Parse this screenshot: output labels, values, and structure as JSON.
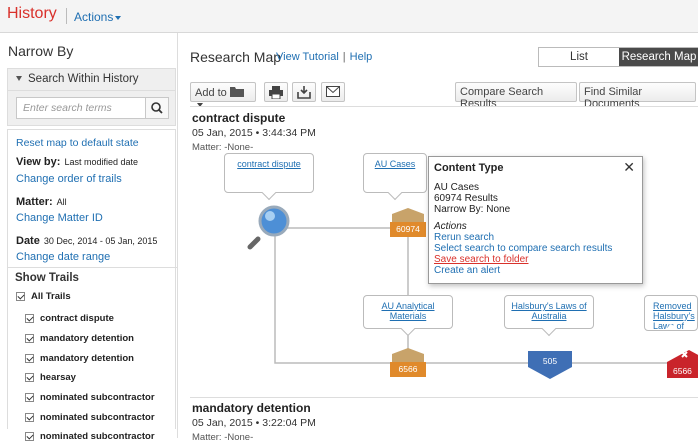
{
  "topbar": {
    "title": "History",
    "actions_label": "Actions"
  },
  "sidebar": {
    "title": "Narrow By",
    "search_within": {
      "label": "Search Within History",
      "placeholder": "Enter search terms"
    },
    "reset_link": "Reset map to default state",
    "view_by": {
      "label": "View by:",
      "value": "Last modified date",
      "link": "Change order of trails"
    },
    "matter": {
      "label": "Matter:",
      "value": "All",
      "link": "Change Matter ID"
    },
    "date": {
      "label": "Date",
      "value": "30 Dec, 2014 - 05 Jan, 2015",
      "link": "Change date range"
    },
    "show_trails": {
      "title": "Show Trails",
      "all_label": "All Trails",
      "items": [
        "contract dispute",
        "mandatory detention",
        "mandatory detention",
        "hearsay",
        "nominated subcontractor",
        "nominated subcontractor",
        "nominated subcontractor"
      ]
    }
  },
  "main": {
    "title": "Research Map",
    "view_tutorial": "View Tutorial",
    "help": "Help",
    "view_list": "List",
    "view_map": "Research Map",
    "toolbar": {
      "add_to": "Add to",
      "compare": "Compare Search Results",
      "similar": "Find Similar Documents"
    },
    "trails": [
      {
        "title": "contract dispute",
        "date": "05 Jan, 2015  • 3:44:34 PM",
        "matter": "Matter: -None-",
        "nodes": {
          "query": "contract dispute",
          "au_cases": "AU Cases",
          "au_cases_count": "60974",
          "au_analytical": "AU Analytical Materials",
          "au_analytical_count": "6566",
          "halsbury": "Halsbury's Laws of Australia",
          "halsbury_count": "505",
          "removed": "Removed Halsbury's Laws of Australia",
          "removed_count": "6566"
        }
      },
      {
        "title": "mandatory detention",
        "date": "05 Jan, 2015  • 3:22:04 PM",
        "matter": "Matter: -None-"
      }
    ],
    "popup": {
      "title": "Content Type",
      "line1": "AU Cases",
      "line2": "60974 Results",
      "line3": "Narrow By: None",
      "actions_label": "Actions",
      "links": [
        "Rerun search",
        "Select search to compare search results",
        "Save search to folder",
        "Create an alert"
      ]
    }
  },
  "colors": {
    "accent": "#1f6fb2",
    "brand": "#d9312b",
    "folder": "#e08a2b",
    "halsbury": "#3f6fb5",
    "removed": "#c9242b"
  }
}
